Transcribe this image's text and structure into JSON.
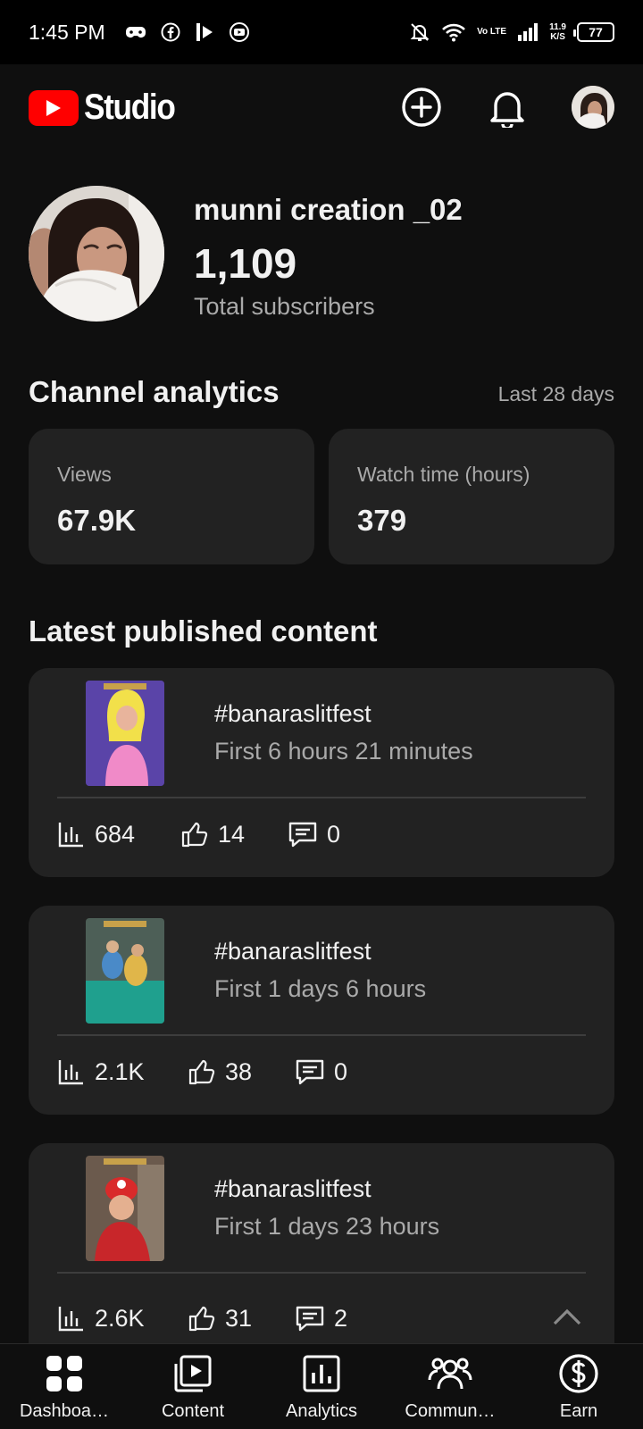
{
  "status_bar": {
    "time": "1:45 PM",
    "left_icons": [
      "game-controller-icon",
      "facebook-icon",
      "video-app-icon",
      "youtube-studio-icon"
    ],
    "volte": "Vo LTE",
    "net_speed_value": "11.9",
    "net_speed_unit": "K/S",
    "battery": "77"
  },
  "app_bar": {
    "logo_text": "Studio",
    "brand_color": "#ff0000"
  },
  "channel": {
    "name": "munni creation _02",
    "subscribers": "1,109",
    "subscribers_label": "Total subscribers"
  },
  "analytics": {
    "title": "Channel analytics",
    "range": "Last 28 days",
    "cards": [
      {
        "label": "Views",
        "value": "67.9K"
      },
      {
        "label": "Watch time (hours)",
        "value": "379"
      }
    ]
  },
  "latest": {
    "title": "Latest published content",
    "items": [
      {
        "title": "#banaraslitfest",
        "subtitle": "First 6 hours 21 minutes",
        "views": "684",
        "likes": "14",
        "comments": "0"
      },
      {
        "title": "#banaraslitfest",
        "subtitle": "First 1 days 6 hours",
        "views": "2.1K",
        "likes": "38",
        "comments": "0"
      },
      {
        "title": "#banaraslitfest",
        "subtitle": "First 1 days 23 hours",
        "views": "2.6K",
        "likes": "31",
        "comments": "2"
      }
    ]
  },
  "bottom_nav": [
    {
      "label": "Dashboa…",
      "icon": "dashboard-icon"
    },
    {
      "label": "Content",
      "icon": "content-icon"
    },
    {
      "label": "Analytics",
      "icon": "analytics-icon"
    },
    {
      "label": "Commun…",
      "icon": "community-icon"
    },
    {
      "label": "Earn",
      "icon": "earn-icon"
    }
  ]
}
